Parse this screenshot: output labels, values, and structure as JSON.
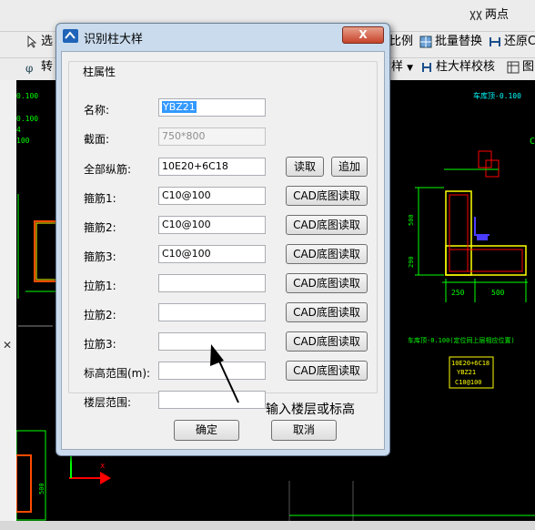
{
  "app": {
    "toolbar": {
      "two_point": "两点",
      "select": "选",
      "scale": "比例",
      "batch_replace": "批量替换",
      "restore": "还原C",
      "convert": "转",
      "big_sample": "柱大样",
      "column_check": "柱大样校核",
      "figure": "图"
    }
  },
  "cad": {
    "texts": {
      "t1": "0.100",
      "t2": "-0.100",
      "t3": "0.100",
      "t4": "4",
      "t5": "100",
      "t6": "C",
      "t7": "车库顶-0.100",
      "t8": "250",
      "t9": "500",
      "t10": "车库顶-0.100(定位同上层相应位置)",
      "t11": "10E20+6C18",
      "t12": "YBZ21",
      "t13": "C10@100",
      "t14": "250",
      "t15": "500",
      "t16": "500",
      "t17": "290"
    }
  },
  "dialog": {
    "title": "识别柱大样",
    "group_title": "柱属性",
    "fields": {
      "name": {
        "label": "名称:",
        "value": "YBZ21"
      },
      "section": {
        "label": "截面:",
        "value": "750*800"
      },
      "long_bars": {
        "label": "全部纵筋:",
        "value": "10E20+6C18",
        "read_label": "读取",
        "append_label": "追加"
      },
      "stirrup1": {
        "label": "箍筋1:",
        "value": "C10@100",
        "btn": "CAD底图读取"
      },
      "stirrup2": {
        "label": "箍筋2:",
        "value": "C10@100",
        "btn": "CAD底图读取"
      },
      "stirrup3": {
        "label": "箍筋3:",
        "value": "C10@100",
        "btn": "CAD底图读取"
      },
      "tie1": {
        "label": "拉筋1:",
        "value": "",
        "btn": "CAD底图读取"
      },
      "tie2": {
        "label": "拉筋2:",
        "value": "",
        "btn": "CAD底图读取"
      },
      "tie3": {
        "label": "拉筋3:",
        "value": "",
        "btn": "CAD底图读取"
      },
      "elev": {
        "label": "标高范围(m):",
        "value": "",
        "btn": "CAD底图读取"
      },
      "floor": {
        "label": "楼层范围:",
        "value": ""
      }
    },
    "ok": "确定",
    "cancel": "取消",
    "close": "X"
  },
  "annotation": "输入楼层或标高",
  "colors": {
    "cad_bg": "#000000",
    "rebar": "#ff0000",
    "dim": "#00ff00",
    "outline": "#ffff00",
    "text_cyan": "#00ffff",
    "text_green": "#00ff00",
    "stirrup_blue": "#4a3cff"
  }
}
